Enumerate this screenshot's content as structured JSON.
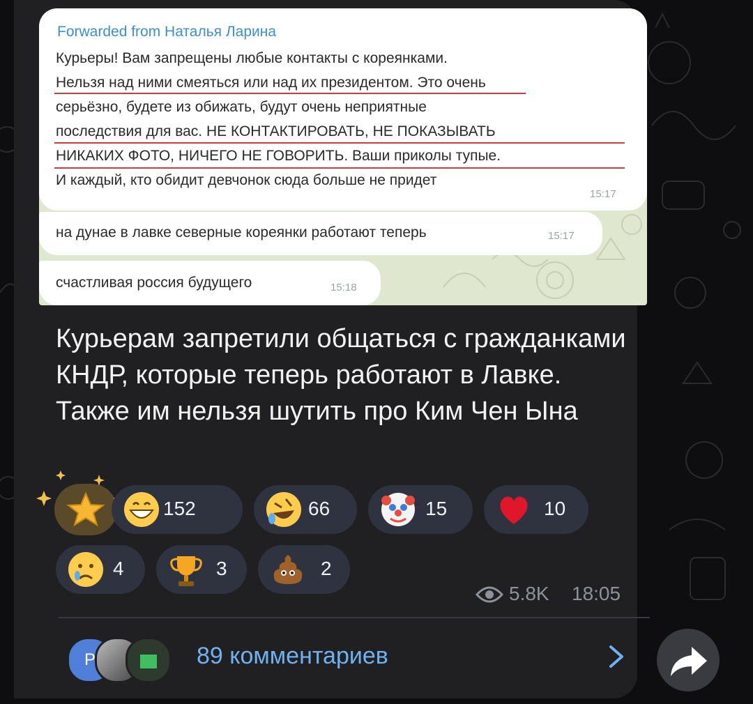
{
  "screenshot": {
    "forwarded_from": "Forwarded from Наталья Ларина",
    "lines": [
      "Курьеры! Вам запрещены любые контакты с кореянками.",
      "Нельзя над ними смеяться или  над их президентом. Это очень",
      "серьёзно, будете из обижать, будут очень неприятные",
      "последствия для вас. НЕ  КОНТАКТИРОВАТЬ,  НЕ ПОКАЗЫВАТЬ",
      "НИКАКИХ ФОТО, НИЧЕГО  НЕ ГОВОРИТЬ. Ваши приколы тупые.",
      "И каждый,  кто обидит девчонок сюда больше не придет"
    ],
    "time1": "15:17",
    "msg2": "на дунае в лавке северные кореянки работают теперь",
    "time2": "15:17",
    "msg3": "счастливая россия будущего",
    "time3": "15:18"
  },
  "caption": "Курьерам запретили общаться с гражданками КНДР, которые теперь работают в Лавке. Также им нельзя шутить про Ким Чен Ына",
  "reactions": [
    {
      "icon": "grin-emoji",
      "count": "152"
    },
    {
      "icon": "rofl-emoji",
      "count": "66"
    },
    {
      "icon": "clown-emoji",
      "count": "15"
    },
    {
      "icon": "heart-emoji",
      "count": "10"
    },
    {
      "icon": "crying-emoji",
      "count": "4"
    },
    {
      "icon": "trophy-emoji",
      "count": "3"
    },
    {
      "icon": "poop-emoji",
      "count": "2"
    }
  ],
  "paid_reaction_icon": "star-icon",
  "views": "5.8K",
  "time": "18:05",
  "avatar_letter": "P",
  "comments_label": "89 комментариев",
  "colors": {
    "accent": "#6fb2ef",
    "bubble_bg": "#202022",
    "reaction_bg": "#2f3340",
    "underline": "#d23b3b"
  }
}
